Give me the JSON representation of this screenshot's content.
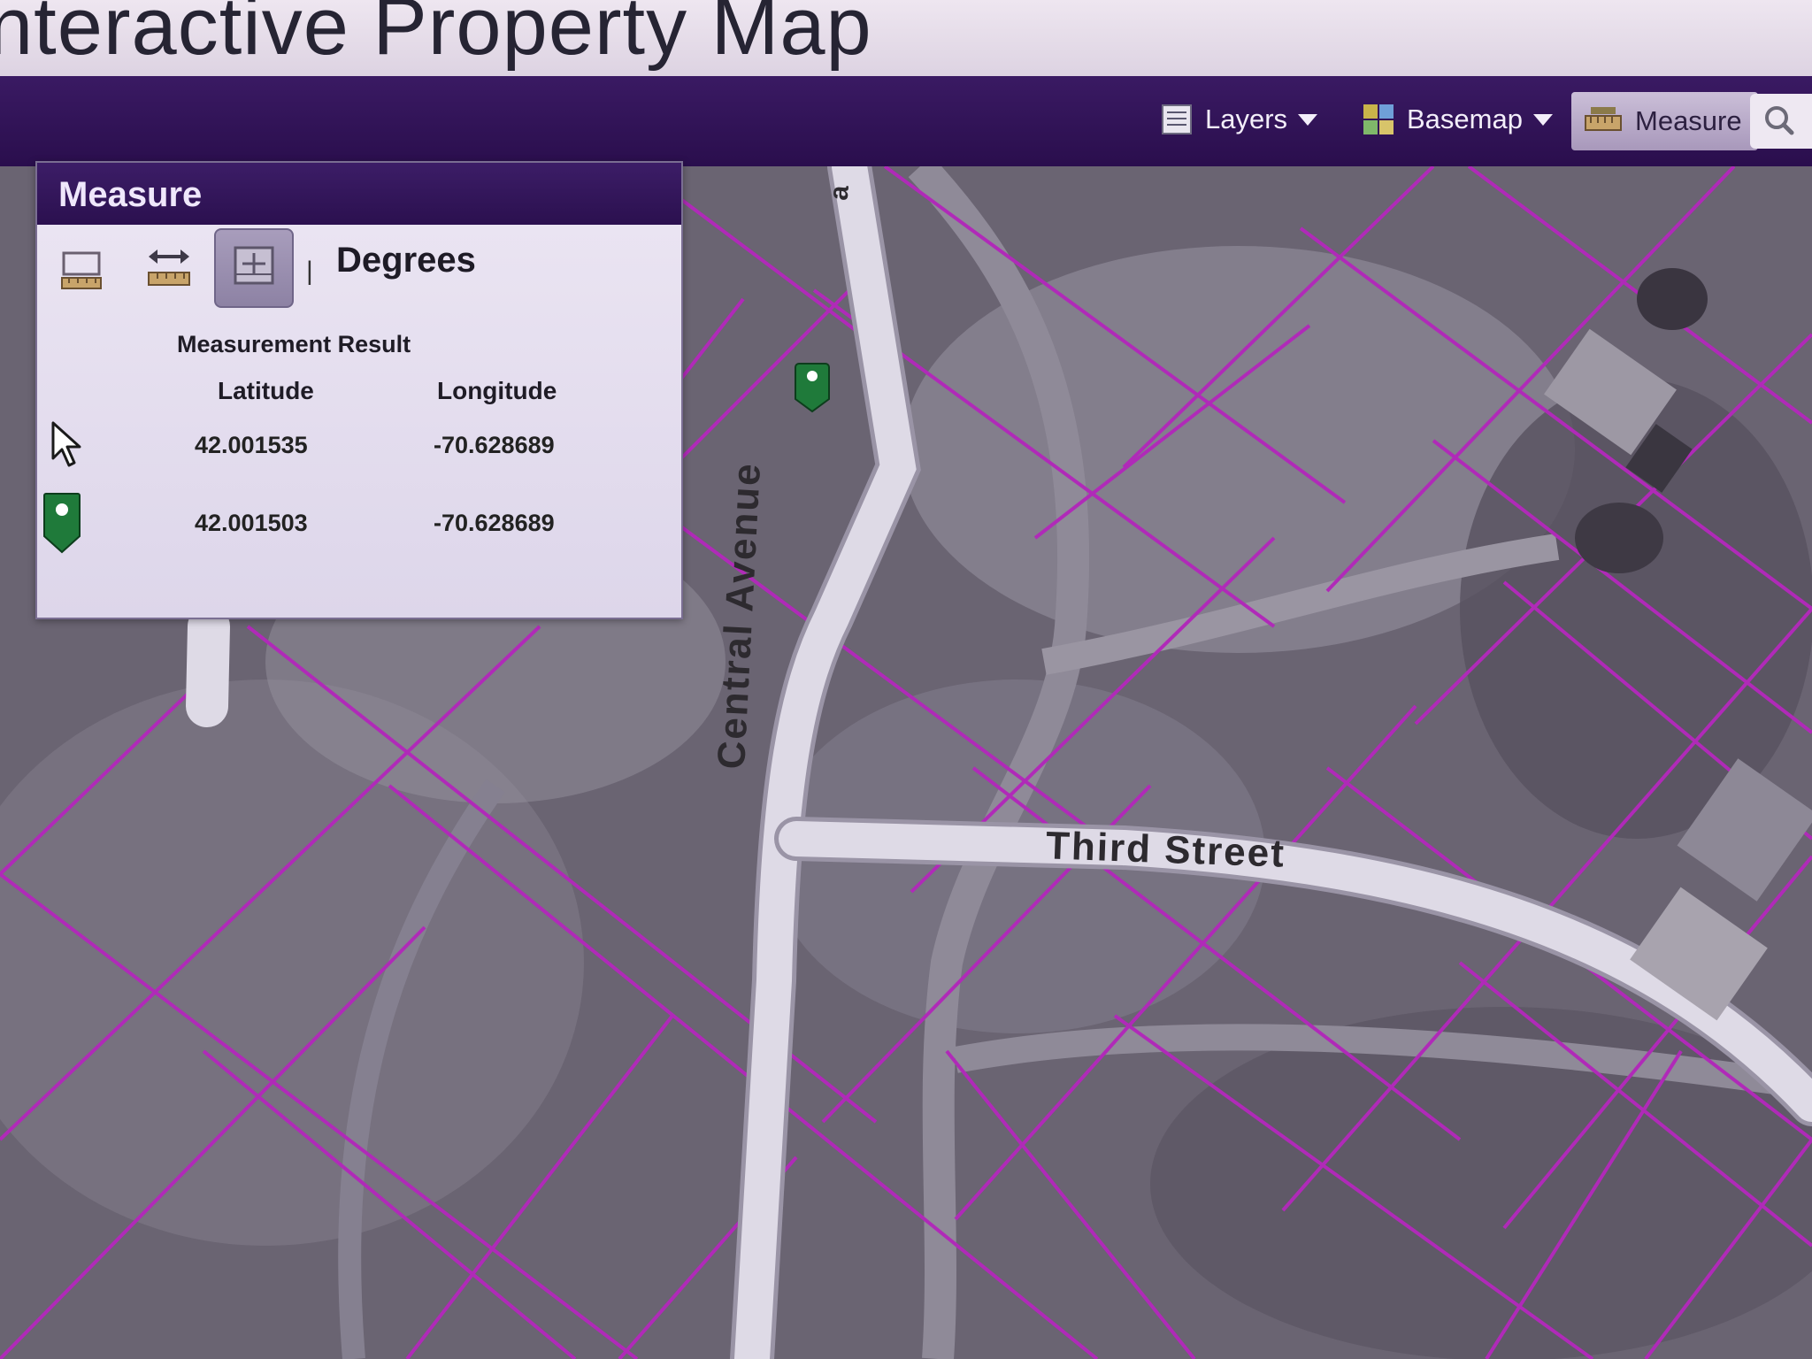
{
  "app": {
    "title": "nteractive Property Map"
  },
  "toolbar": {
    "layers_label": "Layers",
    "basemap_label": "Basemap",
    "measure_label": "Measure",
    "icons": {
      "layers": "layers-icon",
      "basemap": "basemap-grid-icon",
      "measure": "ruler-icon",
      "search": "search-icon"
    }
  },
  "measure_panel": {
    "title": "Measure",
    "tools": [
      "area-icon",
      "distance-icon",
      "location-icon"
    ],
    "units": "Degrees",
    "separator": "|",
    "result_label": "Measurement Result",
    "columns": {
      "latitude": "Latitude",
      "longitude": "Longitude"
    },
    "rows": [
      {
        "marker": "cursor-icon",
        "latitude": "42.001535",
        "longitude": "-70.628689"
      },
      {
        "marker": "map-pin-icon",
        "latitude": "42.001503",
        "longitude": "-70.628689"
      }
    ]
  },
  "map": {
    "streets": {
      "central": "Central Avenue",
      "third": "Third Street",
      "partial": "a"
    },
    "colors": {
      "parcel_lines": "#b02ab8",
      "road": "#dedae6",
      "terrain": "#6e6878",
      "marker": "#1f7a3a"
    }
  }
}
